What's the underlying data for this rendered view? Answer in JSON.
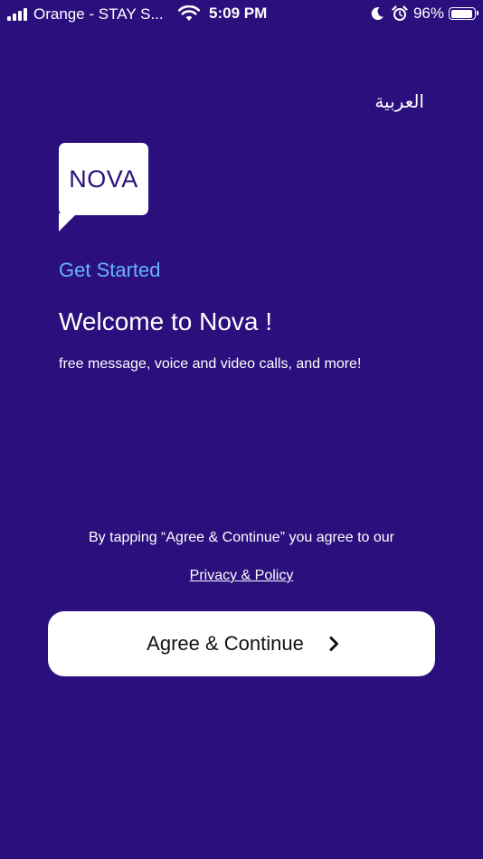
{
  "status_bar": {
    "carrier": "Orange - STAY S...",
    "time": "5:09 PM",
    "battery_percent": "96%",
    "battery_level": 0.96,
    "icons": [
      "signal-icon",
      "wifi-icon",
      "moon-icon",
      "alarm-icon",
      "battery-icon"
    ]
  },
  "language_toggle": "العربية",
  "logo": {
    "text": "NOVA"
  },
  "get_started": "Get Started",
  "welcome_title": "Welcome to Nova !",
  "tagline": "free message, voice and video calls, and more!",
  "agreement": {
    "note": "By tapping “Agree & Continue” you agree to our",
    "privacy_link": "Privacy & Policy"
  },
  "cta": {
    "label": "Agree & Continue",
    "icon": "chevron-right-icon"
  },
  "colors": {
    "background": "#2b0f7d",
    "accent": "#64b5f6",
    "button_background": "#ffffff",
    "text": "#ffffff"
  }
}
